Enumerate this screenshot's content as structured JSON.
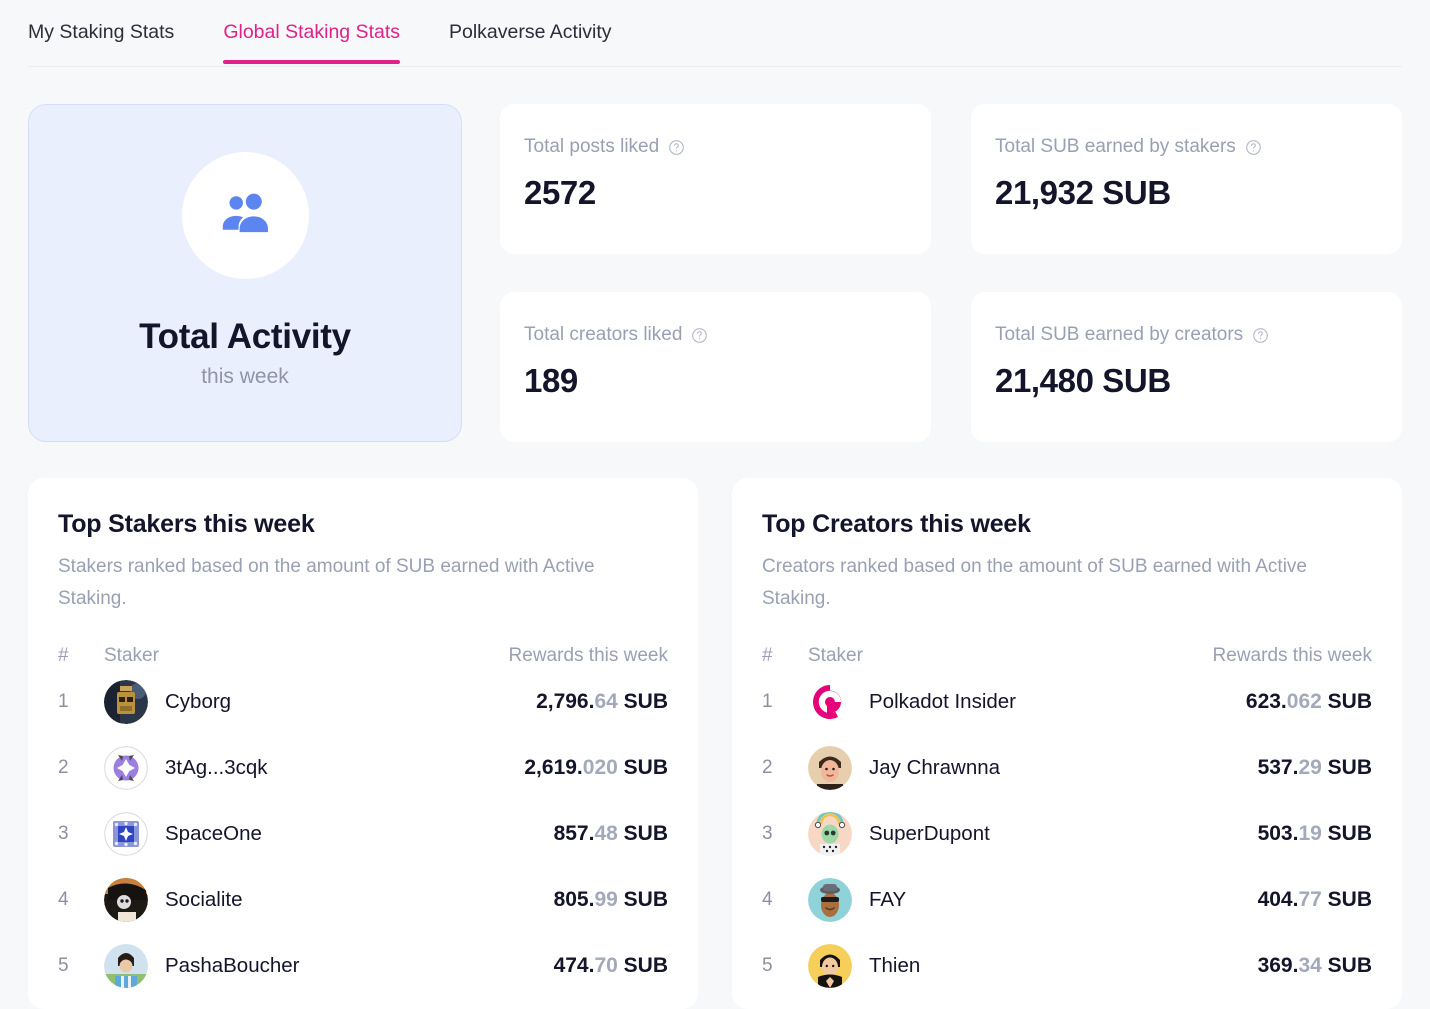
{
  "theme": {
    "accent": "#e0218a",
    "page_bg": "#f7f8fa",
    "card_bg": "#ffffff",
    "activity_card_bg": "#e9effd",
    "muted_text": "#9aa0b4",
    "value_text": "#14142b",
    "decimal_text": "#a3a8bb",
    "avatar_icon_blue": "#5c85f0"
  },
  "tabs": [
    {
      "label": "My Staking Stats",
      "active": false
    },
    {
      "label": "Global Staking Stats",
      "active": true
    },
    {
      "label": "Polkaverse Activity",
      "active": false
    }
  ],
  "activity_card": {
    "icon": "people-group-icon",
    "title": "Total Activity",
    "subtitle": "this week"
  },
  "stats": [
    {
      "label": "Total posts liked",
      "value": "2572",
      "help_icon": "question-circle-icon"
    },
    {
      "label": "Total SUB earned by stakers",
      "value": "21,932 SUB",
      "help_icon": "question-circle-icon"
    },
    {
      "label": "Total creators liked",
      "value": "189",
      "help_icon": "question-circle-icon"
    },
    {
      "label": "Total SUB earned by creators",
      "value": "21,480 SUB",
      "help_icon": "question-circle-icon"
    }
  ],
  "panels": [
    {
      "title": "Top Stakers this week",
      "description": "Stakers ranked based on the amount of SUB earned with Active Staking.",
      "columns": {
        "rank": "#",
        "name": "Staker",
        "reward": "Rewards this week"
      },
      "rows": [
        {
          "rank": "1",
          "name": "Cyborg",
          "avatar": "avatar-cyborg",
          "whole": "2,796.",
          "decimal": "64",
          "unit": " SUB"
        },
        {
          "rank": "2",
          "name": "3tAg...3cqk",
          "avatar": "avatar-identicon-purple",
          "whole": "2,619.",
          "decimal": "020",
          "unit": " SUB"
        },
        {
          "rank": "3",
          "name": "SpaceOne",
          "avatar": "avatar-identicon-blue",
          "whole": "857.",
          "decimal": "48",
          "unit": " SUB"
        },
        {
          "rank": "4",
          "name": "Socialite",
          "avatar": "avatar-socialite",
          "whole": "805.",
          "decimal": "99",
          "unit": " SUB"
        },
        {
          "rank": "5",
          "name": "PashaBoucher",
          "avatar": "avatar-pasha",
          "whole": "474.",
          "decimal": "70",
          "unit": " SUB"
        }
      ]
    },
    {
      "title": "Top Creators this week",
      "description": "Creators ranked based on the amount of SUB earned with Active Staking.",
      "columns": {
        "rank": "#",
        "name": "Staker",
        "reward": "Rewards this week"
      },
      "rows": [
        {
          "rank": "1",
          "name": "Polkadot Insider",
          "avatar": "avatar-polkadot-logo",
          "whole": "623.",
          "decimal": "062",
          "unit": " SUB"
        },
        {
          "rank": "2",
          "name": "Jay Chrawnna",
          "avatar": "avatar-jay",
          "whole": "537.",
          "decimal": "29",
          "unit": " SUB"
        },
        {
          "rank": "3",
          "name": "SuperDupont",
          "avatar": "avatar-superdupont",
          "whole": "503.",
          "decimal": "19",
          "unit": " SUB"
        },
        {
          "rank": "4",
          "name": "FAY",
          "avatar": "avatar-fay",
          "whole": "404.",
          "decimal": "77",
          "unit": " SUB"
        },
        {
          "rank": "5",
          "name": "Thien",
          "avatar": "avatar-thien",
          "whole": "369.",
          "decimal": "34",
          "unit": " SUB"
        }
      ]
    }
  ]
}
